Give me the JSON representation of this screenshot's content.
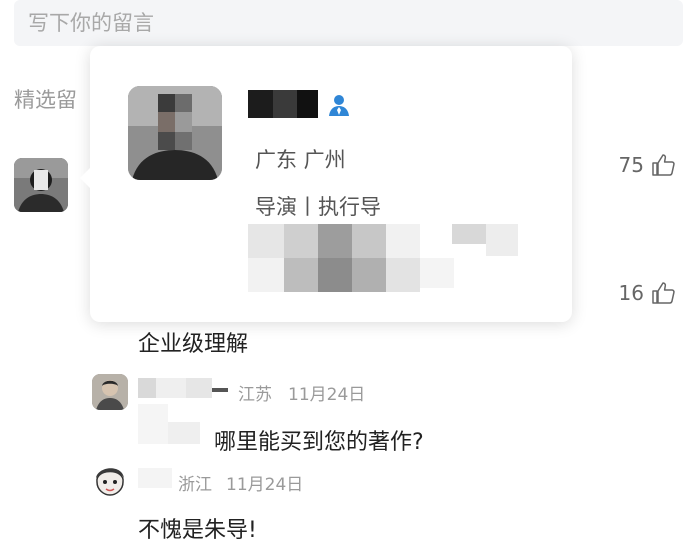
{
  "comment_box": {
    "placeholder": "写下你的留言"
  },
  "section": {
    "title": "精选留"
  },
  "comments": [
    {
      "likes": "75"
    },
    {
      "likes": "16",
      "body": "企业级理解"
    }
  ],
  "replies": [
    {
      "location": "江苏",
      "date": "11月24日",
      "text": "哪里能买到您的著作?"
    },
    {
      "location": "浙江",
      "date": "11月24日",
      "text": "不愧是朱导!"
    }
  ],
  "profile_popup": {
    "location": "广东 广州",
    "title": "导演丨执行导",
    "verified_icon": "verified-user-icon"
  },
  "colors": {
    "verified": "#2f86d6",
    "muted": "#9a9a9a",
    "input_bg": "#f4f5f7"
  }
}
